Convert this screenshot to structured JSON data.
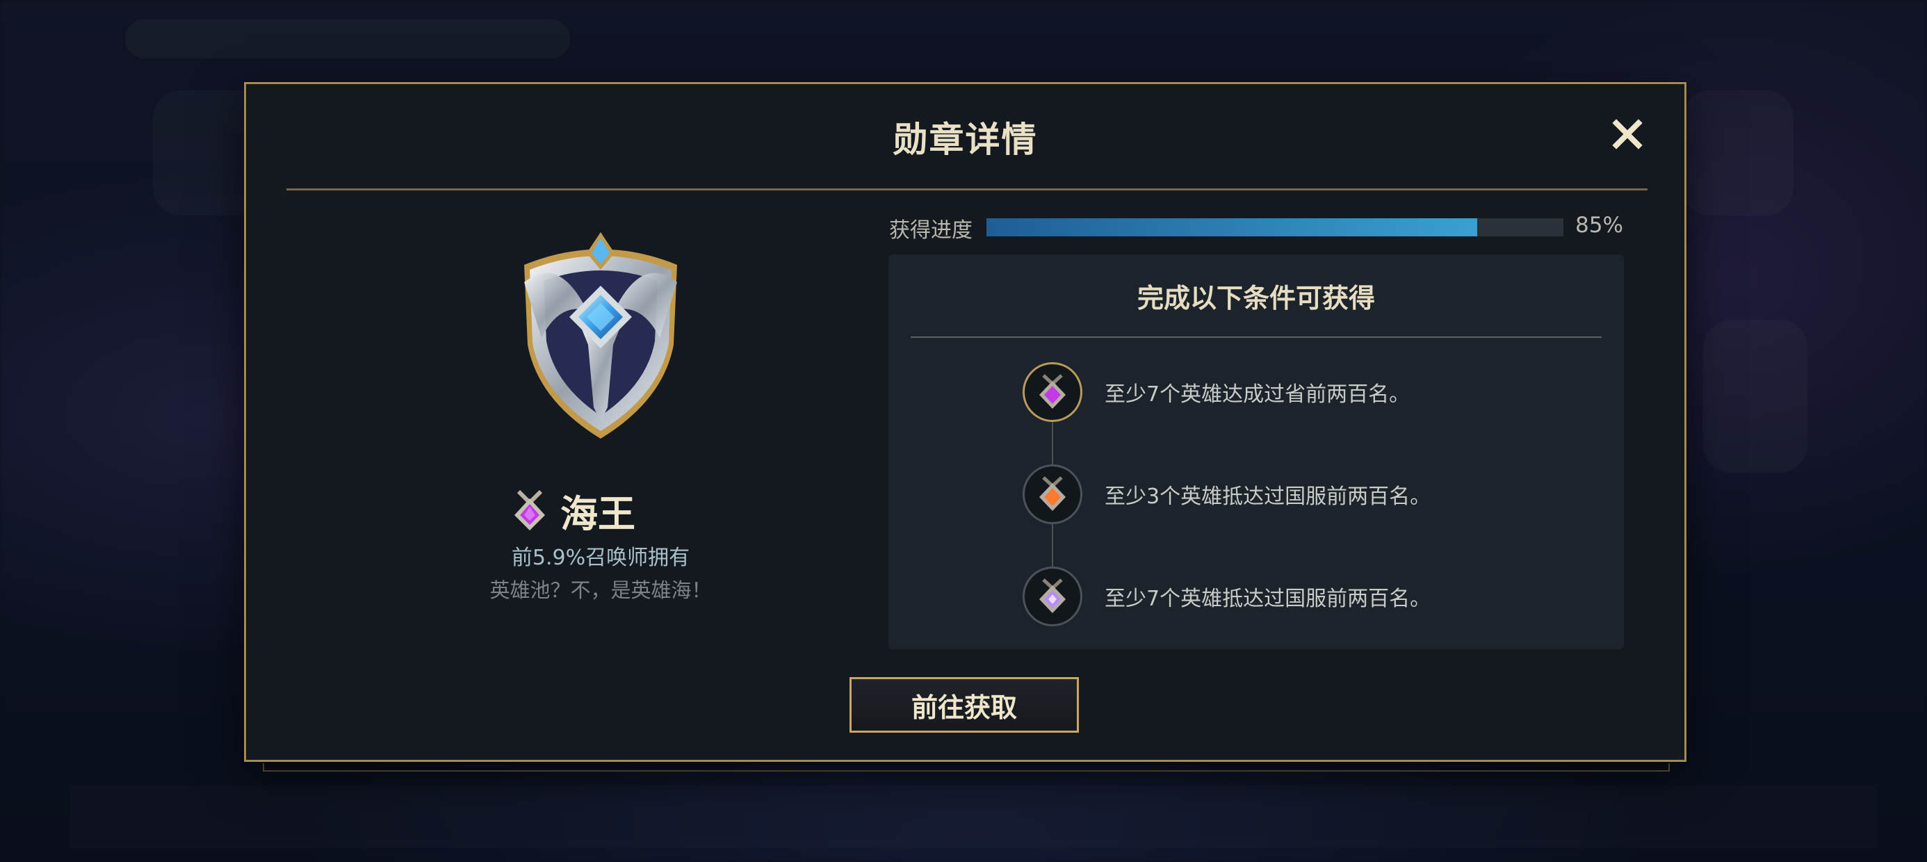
{
  "modal": {
    "title": "勋章详情",
    "close_icon": "close-icon"
  },
  "badge": {
    "name": "海王",
    "owned_text": "前5.9%召唤师拥有",
    "slogan": "英雄池？不，是英雄海！",
    "icon": "shield-medal-icon"
  },
  "progress": {
    "label": "获得进度",
    "value": 0.85,
    "percent_text": "85%",
    "fill_color": "#3aa0d0"
  },
  "conditions": {
    "title": "完成以下条件可获得",
    "items": [
      {
        "text": "至少7个英雄达成过省前两百名。",
        "gem_color": "#c23be6",
        "icon": "purple-medal-icon",
        "active": true
      },
      {
        "text": "至少3个英雄抵达过国服前两百名。",
        "gem_color": "#ff7a2e",
        "icon": "orange-medal-icon",
        "active": false
      },
      {
        "text": "至少7个英雄抵达过国服前两百名。",
        "gem_color": "#b48cff",
        "icon": "violet-medal-icon",
        "active": false
      }
    ]
  },
  "actions": {
    "go_label": "前往获取"
  },
  "colors": {
    "gold_border": "#a88a4f",
    "panel_bg": "#13191f"
  }
}
